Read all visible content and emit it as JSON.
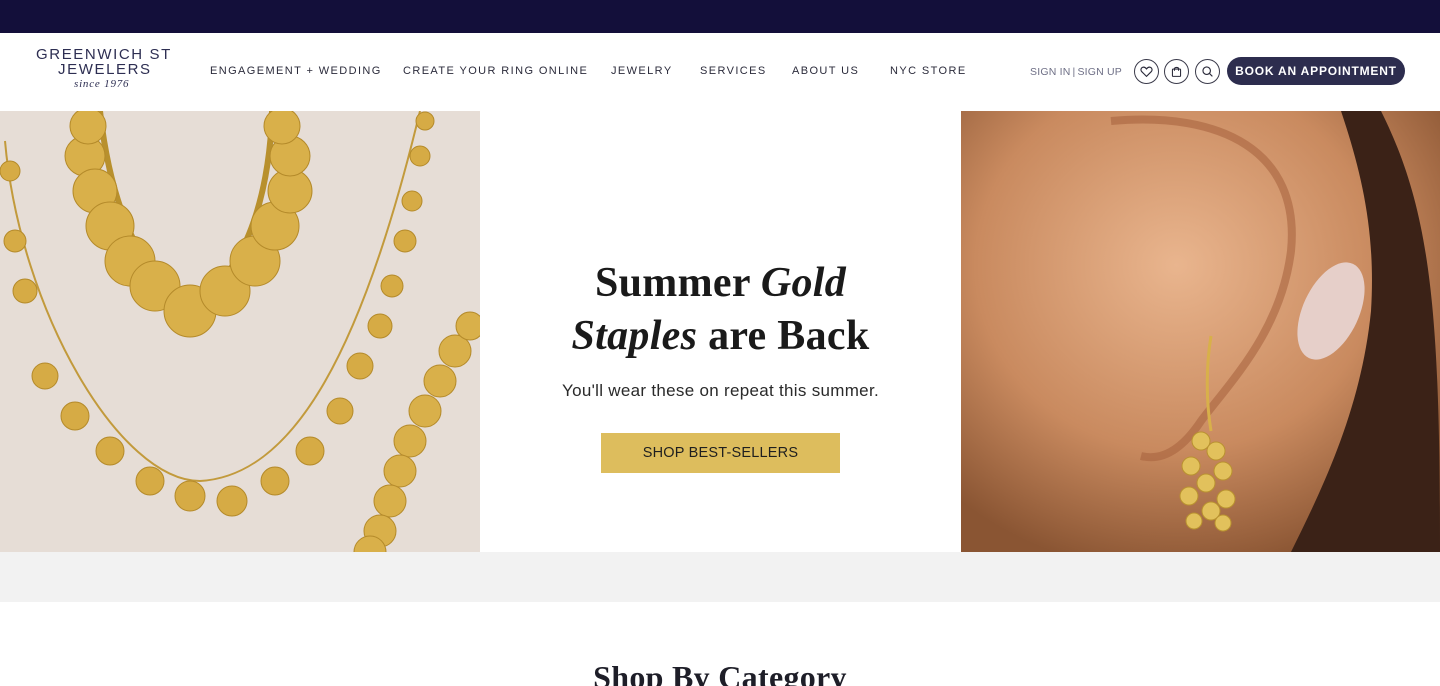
{
  "brand": {
    "line1": "GREENWICH ST",
    "line2": "JEWELERS",
    "since": "since 1976"
  },
  "nav": [
    {
      "label": "ENGAGEMENT + WEDDING"
    },
    {
      "label": "CREATE YOUR RING ONLINE"
    },
    {
      "label": "JEWELRY"
    },
    {
      "label": "SERVICES"
    },
    {
      "label": "ABOUT US"
    },
    {
      "label": "NYC STORE"
    }
  ],
  "account": {
    "sign_in": "SIGN IN",
    "separator": "|",
    "sign_up": "SIGN UP"
  },
  "header_icons": [
    "heart-icon",
    "shopping-bag-icon",
    "search-icon"
  ],
  "book_button": "BOOK AN APPOINTMENT",
  "hero": {
    "headline_word1": "Summer",
    "headline_italic1": "Gold",
    "headline_italic2": "Staples",
    "headline_rest": "are Back",
    "subheading": "You'll wear these on repeat this summer.",
    "cta": "SHOP BEST-SELLERS"
  },
  "section": {
    "title": "Shop By Category"
  },
  "colors": {
    "top_bar": "#130f3a",
    "primary_button": "#2d2d4e",
    "cta_gold": "#ddbd5d",
    "band_gray": "#f2f2f2"
  }
}
